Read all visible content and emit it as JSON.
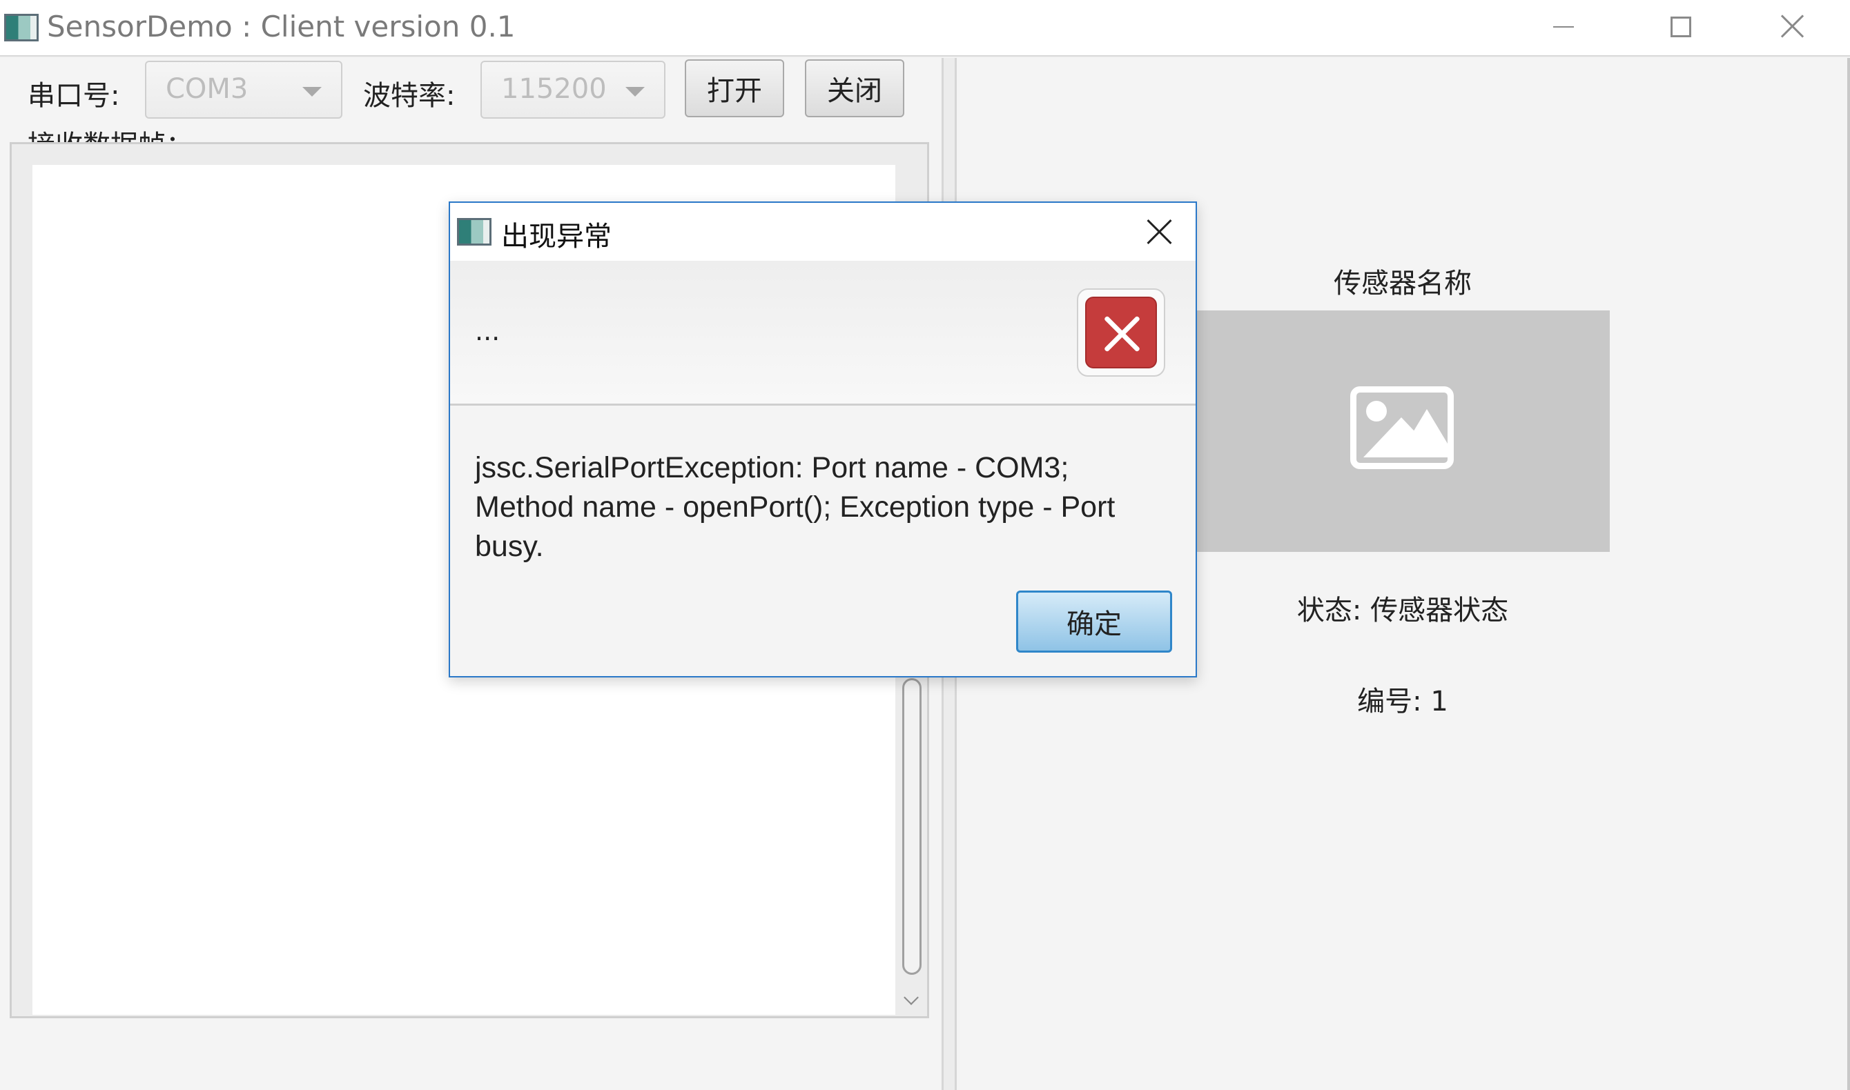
{
  "window": {
    "title": "SensorDemo : Client version 0.1"
  },
  "toolbar": {
    "port_label": "串口号:",
    "port_value": "COM3",
    "baud_label": "波特率:",
    "baud_value": "115200",
    "open_label": "打开",
    "close_label": "关闭",
    "frames_label": "接收数据帧："
  },
  "sensor": {
    "name": "传感器名称",
    "status": "状态: 传感器状态",
    "number": "编号: 1"
  },
  "dialog": {
    "title": "出现异常",
    "header_text": "...",
    "message": "jssc.SerialPortException: Port name - COM3; Method name - openPort(); Exception type - Port busy.",
    "ok_label": "确定"
  }
}
